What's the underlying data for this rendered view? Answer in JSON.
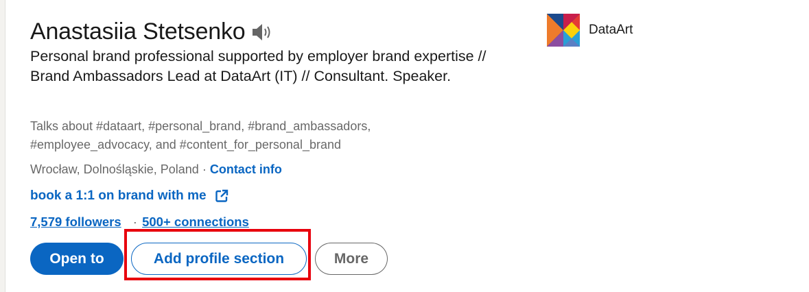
{
  "profile": {
    "name": "Anastasiia Stetsenko",
    "headline": "Personal brand professional supported by employer brand expertise // Brand Ambassadors Lead at DataArt (IT) // Consultant. Speaker.",
    "talks_about": "Talks about #dataart, #personal_brand, #brand_ambassadors, #employee_advocacy, and #content_for_personal_brand",
    "location": "Wrocław, Dolnośląskie, Poland",
    "location_separator": "·",
    "contact_info_label": "Contact info",
    "booking_link_label": "book a 1:1 on brand with me",
    "followers": "7,579 followers",
    "network_separator": "·",
    "connections": "500+ connections"
  },
  "actions": {
    "open_to_label": "Open to",
    "add_section_label": "Add profile section",
    "more_label": "More"
  },
  "company": {
    "name": "DataArt"
  },
  "icons": {
    "pronunciation": "speaker-icon",
    "external_link": "external-link-icon",
    "company_logo": "dataart-logo"
  },
  "colors": {
    "link": "#0a66c2",
    "primary_button": "#0a66c2",
    "highlight": "#e8000d"
  }
}
